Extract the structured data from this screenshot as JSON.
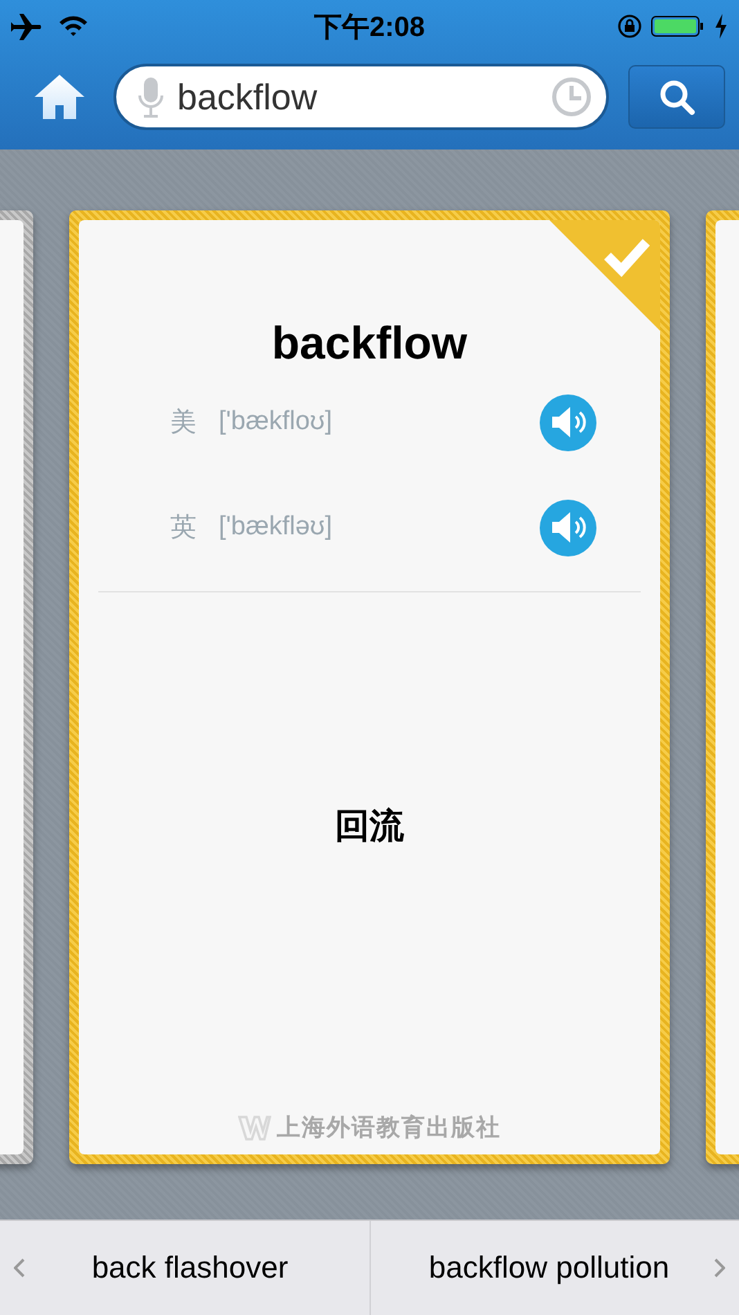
{
  "status_bar": {
    "time": "下午2:08"
  },
  "search": {
    "value": "backflow"
  },
  "side_cards": [
    {
      "checked": false
    },
    {
      "checked": true
    }
  ],
  "card": {
    "word": "backflow",
    "checked": true,
    "pronunciations": [
      {
        "region": "美",
        "phonetic": "['bækfloʊ]"
      },
      {
        "region": "英",
        "phonetic": "['bækfləʊ]"
      }
    ],
    "meaning": "回流",
    "publisher": "上海外语教育出版社"
  },
  "word_nav": {
    "previous": "back flashover",
    "next": "backflow pollution"
  }
}
